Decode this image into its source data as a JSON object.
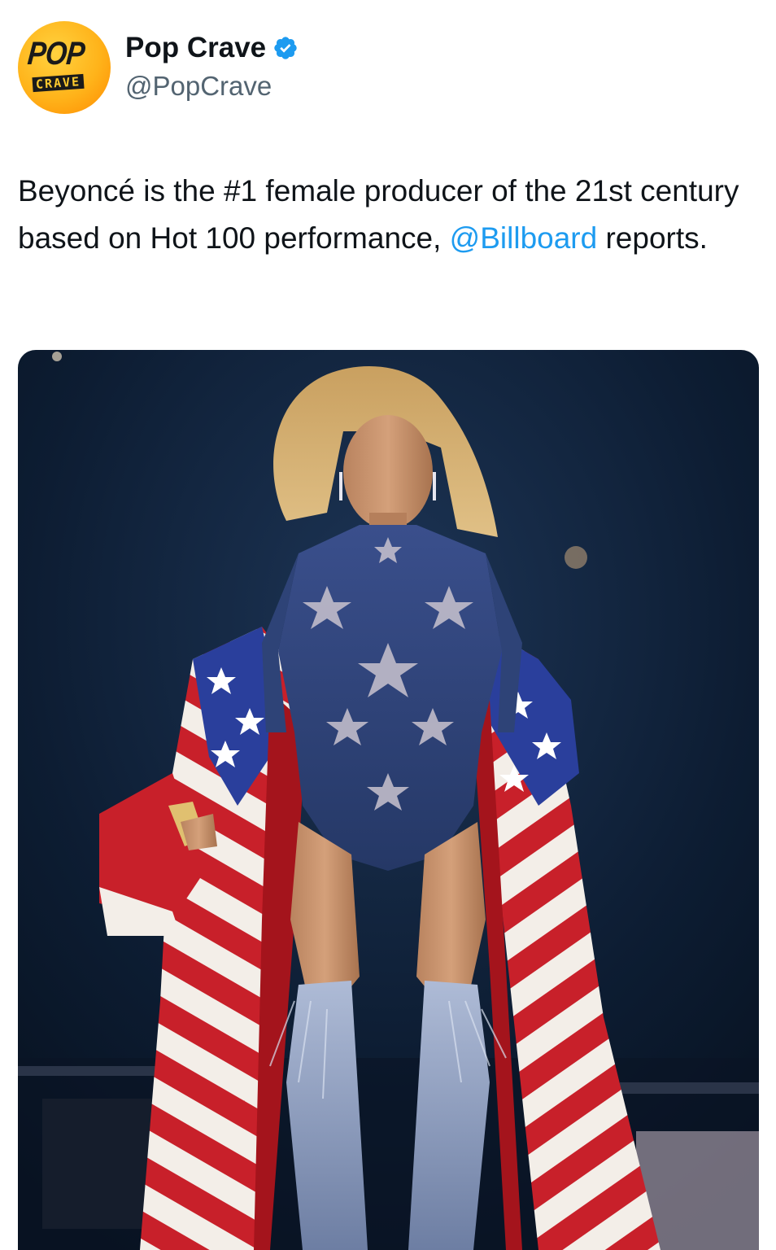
{
  "author": {
    "avatar": {
      "top_text": "POP",
      "bottom_text": "CRAVE"
    },
    "display_name": "Pop Crave",
    "verified_icon": "verified-badge-icon",
    "handle": "@PopCrave"
  },
  "tweet": {
    "text_before": "Beyoncé is the #1 female producer of the 21st century based on Hot 100 performance, ",
    "mention": "@Billboard",
    "text_after": " reports."
  },
  "media": {
    "subject": "performer-photo"
  },
  "colors": {
    "link": "#1d9bf0",
    "verified": "#1d9bf0",
    "handle": "#536471",
    "text": "#0f1419"
  }
}
